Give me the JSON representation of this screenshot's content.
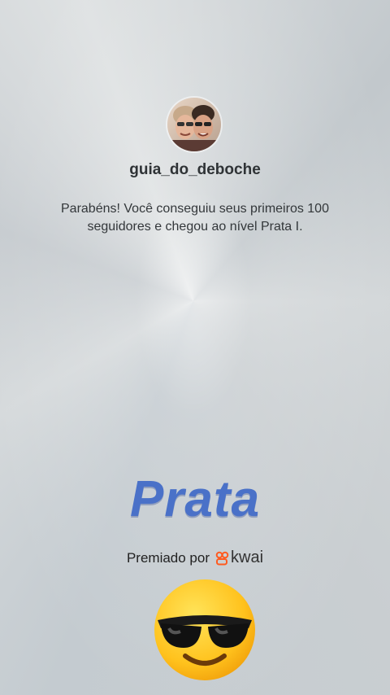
{
  "profile": {
    "avatar_icon": "profile-photo",
    "username": "guia_do_deboche"
  },
  "achievement": {
    "message": "Parabéns! Você conseguiu seus primeiros 100 seguidores e chegou ao nível Prata I.",
    "level_title": "Prata"
  },
  "sponsor": {
    "prefix": "Premiado por",
    "brand": "kwai",
    "brand_icon": "kwai-logo-icon",
    "brand_color": "#ff5a1f"
  },
  "decoration": {
    "emoji": "smiling-face-with-sunglasses-icon"
  },
  "colors": {
    "level_title": "#4a71c8",
    "text": "#33373a"
  }
}
